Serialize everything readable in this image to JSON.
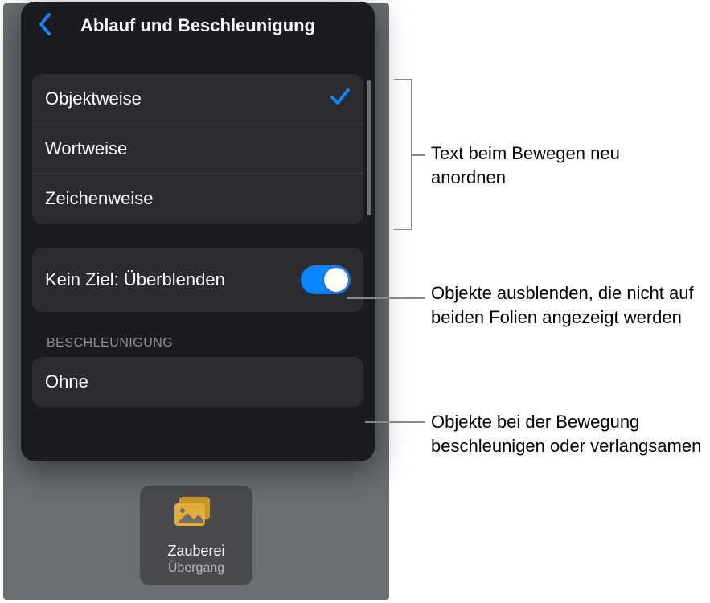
{
  "nav": {
    "title": "Ablauf und Beschleunigung"
  },
  "delivery": {
    "items": [
      {
        "label": "Objektweise",
        "selected": true
      },
      {
        "label": "Wortweise",
        "selected": false
      },
      {
        "label": "Zeichenweise",
        "selected": false
      }
    ]
  },
  "fade": {
    "label": "Kein Ziel: Überblenden",
    "on": true
  },
  "acceleration": {
    "header": "BESCHLEUNIGUNG",
    "value": "Ohne"
  },
  "thumb": {
    "name": "Zauberei",
    "subtitle": "Übergang"
  },
  "callouts": {
    "a": "Text beim Bewegen neu anordnen",
    "b": "Objekte ausblenden, die nicht auf beiden Folien angezeigt werden",
    "c": "Objekte bei der Bewegung beschleunigen oder verlangsamen"
  }
}
